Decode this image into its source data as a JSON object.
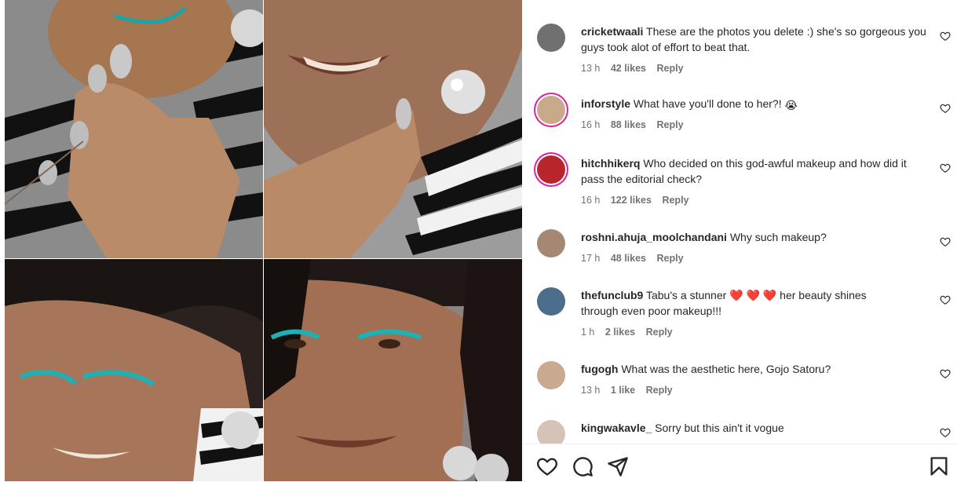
{
  "media": {
    "images": [
      {
        "alt": "woman laughing with silver nails"
      },
      {
        "alt": "smiling with silver earring"
      },
      {
        "alt": "teal eyeliner close-up"
      },
      {
        "alt": "portrait with teal eyeliner"
      }
    ]
  },
  "comments": [
    {
      "user": "cricketwaali",
      "text": "These are the photos you delete :) she's so gorgeous you guys took alot of effort to beat that.",
      "time": "13 h",
      "likes": "42 likes",
      "reply": "Reply",
      "avatar": "#6f6f6f"
    },
    {
      "user": "inforstyle",
      "text": "What have you'll done to her?!",
      "emoji": "😭",
      "time": "16 h",
      "likes": "88 likes",
      "reply": "Reply",
      "avatar": "#c8a98a"
    },
    {
      "user": "hitchhikerq",
      "text": "Who decided on this god-awful makeup and how did it pass the editorial check?",
      "time": "16 h",
      "likes": "122 likes",
      "reply": "Reply",
      "avatar": "#b8262b"
    },
    {
      "user": "roshni.ahuja_moolchandani",
      "text": "Why such makeup?",
      "time": "17 h",
      "likes": "48 likes",
      "reply": "Reply",
      "avatar": "#a58874"
    },
    {
      "user": "thefunclub9",
      "text": "Tabu's a stunner",
      "text2": "her beauty shines through even poor makeup!!!",
      "time": "1 h",
      "likes": "2 likes",
      "reply": "Reply",
      "avatar": "#4c6e8c"
    },
    {
      "user": "fugogh",
      "text": "What was the aesthetic here, Gojo Satoru?",
      "time": "13 h",
      "likes": "1 like",
      "reply": "Reply",
      "avatar": "#c9a98f"
    },
    {
      "user": "kingwakavle_",
      "text": "Sorry but this ain't it vogue",
      "time": "",
      "likes": "",
      "reply": "",
      "avatar": "#d6c2b8"
    }
  ],
  "actions": {
    "like": "heart-outline",
    "comment": "comment-bubble",
    "share": "paper-plane",
    "save": "bookmark"
  },
  "colors": {
    "heart": "#e0245e",
    "ring": "#d6249f",
    "meta": "#737373"
  }
}
